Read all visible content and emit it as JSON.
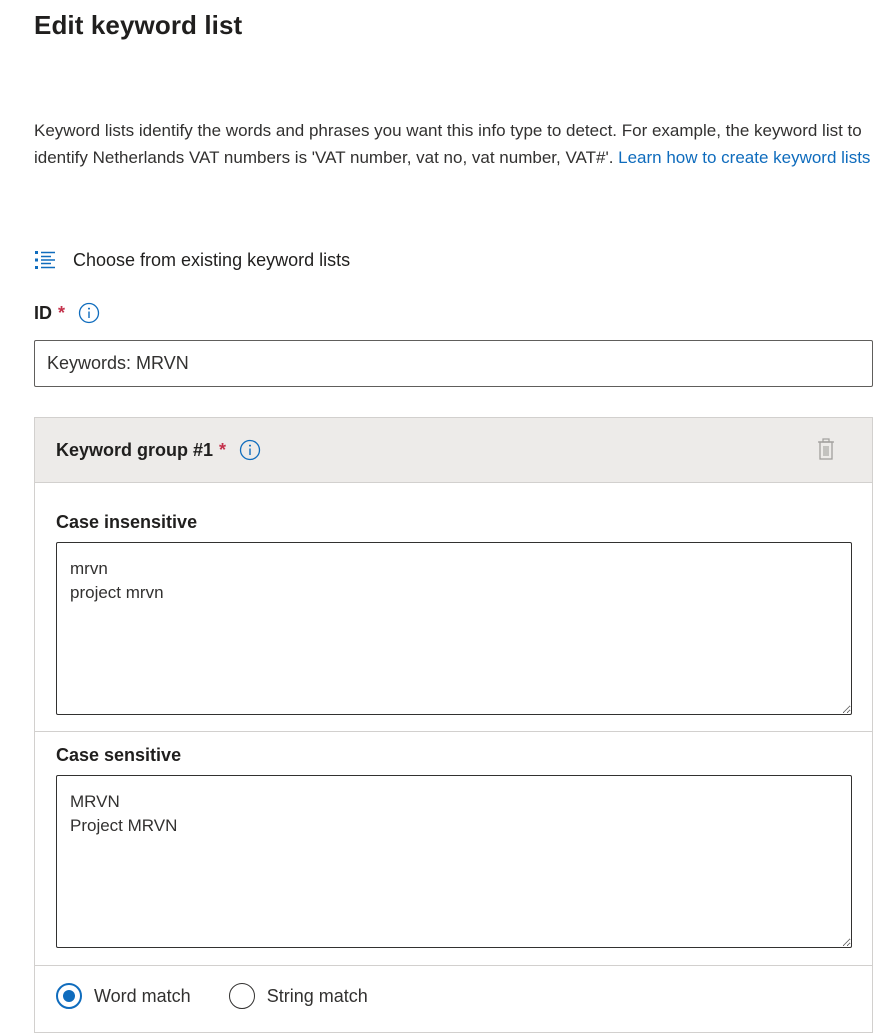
{
  "page": {
    "title": "Edit keyword list"
  },
  "description": {
    "text": "Keyword lists identify the words and phrases you want this info type to detect. For example, the keyword list to identify Netherlands VAT numbers is 'VAT number, vat no, vat number, VAT#'. ",
    "link_label": "Learn how to create keyword lists"
  },
  "choose_existing": {
    "label": "Choose from existing keyword lists",
    "icon": "bulleted-list-icon"
  },
  "id_field": {
    "label": "ID",
    "required_marker": "*",
    "value": "Keywords: MRVN"
  },
  "keyword_group": {
    "title": "Keyword group #1",
    "required_marker": "*",
    "delete_icon": "trash-icon",
    "case_insensitive": {
      "label": "Case insensitive",
      "value": "mrvn\nproject mrvn"
    },
    "case_sensitive": {
      "label": "Case sensitive",
      "value": "MRVN\nProject MRVN"
    },
    "match_options": [
      {
        "label": "Word match",
        "selected": true
      },
      {
        "label": "String match",
        "selected": false
      }
    ]
  },
  "colors": {
    "accent": "#0f6cbd",
    "required": "#c4314b",
    "header_bg": "#edebe9"
  }
}
